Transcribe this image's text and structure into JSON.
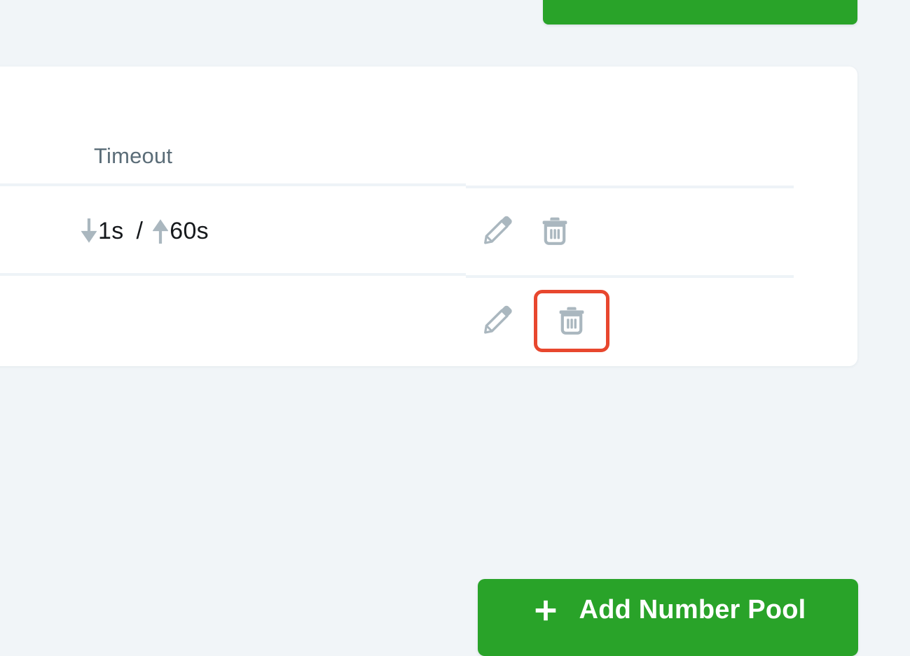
{
  "colors": {
    "page_background": "#f1f5f8",
    "card_background": "#ffffff",
    "primary_green": "#29a329",
    "highlight_red": "#e8472e",
    "header_text": "#5b6d78",
    "value_text": "#16191c",
    "icon_gray": "#aab7bf",
    "divider": "#eef3f7"
  },
  "top_button": {
    "label": "",
    "name": "top-primary-action-button"
  },
  "table": {
    "columns": [
      {
        "header": "Timeout",
        "name": "timeout-column"
      },
      {
        "header": "",
        "name": "actions-column"
      }
    ],
    "rows": [
      {
        "timeout": {
          "down_arrow_icon": "arrow-down-icon",
          "down_value": "1s",
          "separator": "/",
          "up_arrow_icon": "arrow-up-icon",
          "up_value": "60s"
        },
        "actions": {
          "edit_icon": "pencil-icon",
          "delete_icon": "trash-icon",
          "delete_highlighted": false
        }
      },
      {
        "timeout": {
          "down_arrow_icon": "",
          "down_value": "",
          "separator": "",
          "up_arrow_icon": "",
          "up_value": ""
        },
        "actions": {
          "edit_icon": "pencil-icon",
          "delete_icon": "trash-icon",
          "delete_highlighted": true
        }
      }
    ]
  },
  "add_button": {
    "icon": "plus-icon",
    "label": "Add Number Pool"
  }
}
